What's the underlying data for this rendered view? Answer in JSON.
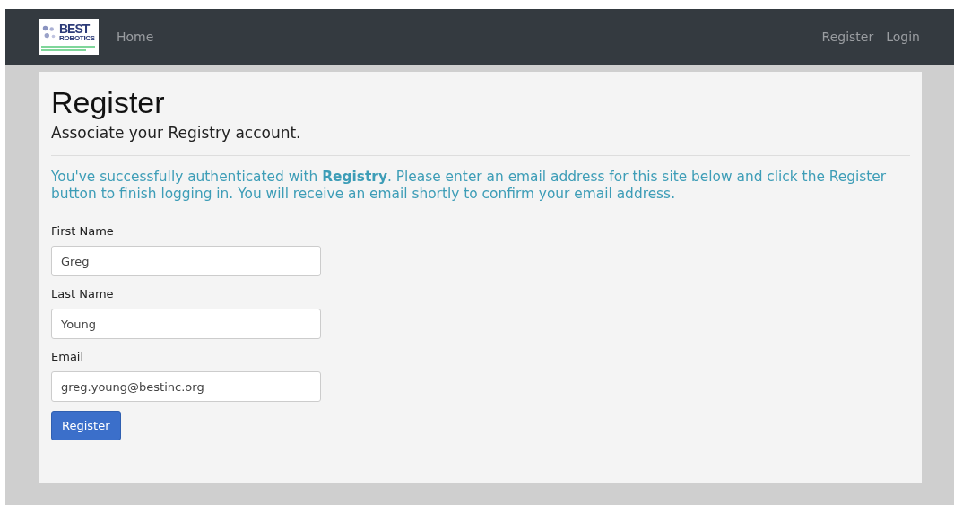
{
  "navbar": {
    "logo": {
      "title": "BEST",
      "subtitle": "ROBOTICS"
    },
    "left_links": [
      "Home"
    ],
    "right_links": [
      "Register",
      "Login"
    ]
  },
  "page": {
    "title": "Register",
    "subtitle": "Associate your Registry account.",
    "message": "You've successfully authenticated with **Registry**. Please enter an email address for this site below and click the Register button to finish logging in. You will receive an email shortly to confirm your email address.",
    "fields": [
      {
        "label": "First Name",
        "value": "Greg"
      },
      {
        "label": "Last Name",
        "value": "Young"
      },
      {
        "label": "Email",
        "value": "greg.young@bestinc.org"
      }
    ],
    "submit": "Register"
  }
}
